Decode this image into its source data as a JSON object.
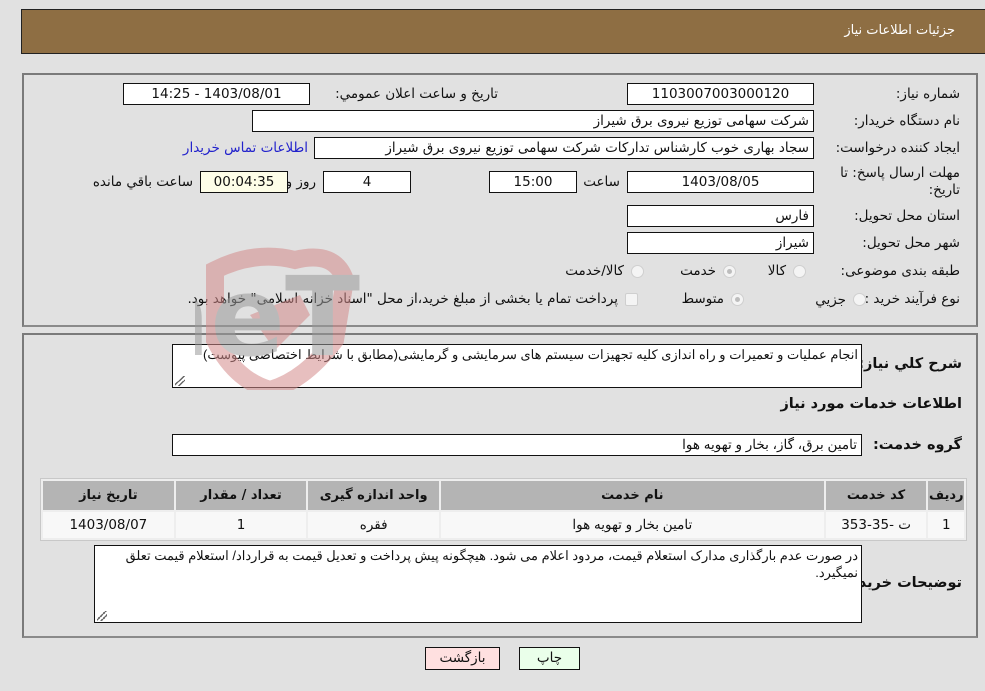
{
  "header": {
    "title": "جزئیات اطلاعات نیاز"
  },
  "details": {
    "need_number": {
      "label": "شماره نیاز:",
      "value": "1103007003000120"
    },
    "announce_datetime": {
      "label": "تاريخ و ساعت اعلان عمومي:",
      "value": "1403/08/01 - 14:25"
    },
    "buyer_org": {
      "label": "نام دستگاه خریدار:",
      "value": "شرکت سهامی توزیع نیروی برق شیراز"
    },
    "requester": {
      "label": "ایجاد کننده درخواست:",
      "value": "سجاد بهاری خوب کارشناس تدارکات شرکت سهامی توزیع نیروی برق شیراز"
    },
    "buyer_contact_link": "اطلاعات تماس خریدار",
    "deadline": {
      "label_line1": "مهلت ارسال پاسخ: تا",
      "label_line2": "تاریخ:",
      "date": "1403/08/05",
      "time_label": "ساعت",
      "time": "15:00",
      "days": "4",
      "days_label": "روز و",
      "remaining": "00:04:35",
      "remaining_label": "ساعت باقي مانده"
    },
    "province": {
      "label": "استان محل تحویل:",
      "value": "فارس"
    },
    "city": {
      "label": "شهر محل تحویل:",
      "value": "شیراز"
    },
    "category": {
      "label": "طبقه بندی موضوعی:",
      "options": [
        {
          "label": "کالا",
          "checked": false
        },
        {
          "label": "خدمت",
          "checked": true
        },
        {
          "label": "کالا/خدمت",
          "checked": false
        }
      ]
    },
    "process_type": {
      "label": "نوع فرآیند خرید :",
      "options": [
        {
          "label": "جزيي",
          "checked": false
        },
        {
          "label": "متوسط",
          "checked": true
        }
      ],
      "treasury_checkbox_label": "پرداخت تمام یا بخشی از مبلغ خرید،از محل \"اسناد خزانه اسلامی\" خواهد بود.",
      "treasury_checked": false
    }
  },
  "summary": {
    "label": "شرح کلي نياز:",
    "value": "انجام عملیات و تعمیرات و راه اندازی کلیه تجهیزات سیستم های سرمایشی و گرمایشی(مطابق با شرایط اختصاصی پیوست)"
  },
  "services": {
    "section_title": "اطلاعات خدمات مورد نیاز",
    "group_label": "گروه خدمت:",
    "group_value": "تامین برق، گاز، بخار و تهویه هوا",
    "table": {
      "columns": [
        "ردیف",
        "کد خدمت",
        "نام خدمت",
        "واحد اندازه گیری",
        "تعداد / مقدار",
        "تاریخ نیاز"
      ],
      "rows": [
        [
          "1",
          "ت -35-353",
          "تامین بخار و تهویه هوا",
          "فقره",
          "1",
          "1403/08/07"
        ]
      ]
    }
  },
  "buyer_notes": {
    "label": "توضیحات خریدار:",
    "value": "در صورت عدم بارگذاری مدارک استعلام قیمت، مردود اعلام می شود. هیچگونه پیش پرداخت و تعدیل قیمت به قرارداد/ استعلام قیمت تعلق نمیگیرد."
  },
  "buttons": {
    "print": "چاپ",
    "back": "بازگشت"
  },
  "watermark": {
    "text": "AriaTender.neT"
  },
  "colors": {
    "header_bg": "#8e6e43",
    "print_bg": "#eaffea",
    "back_bg": "#ffe0e0",
    "link": "#2222cc"
  }
}
